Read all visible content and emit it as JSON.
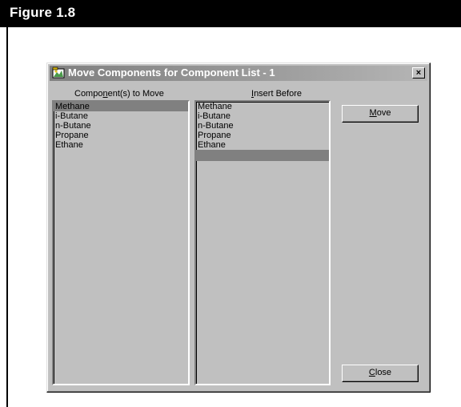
{
  "figure": {
    "title": "Figure 1.8"
  },
  "dialog": {
    "title": "Move Components for Component List - 1",
    "close_glyph": "×"
  },
  "components_to_move": {
    "label_pre": "Compo",
    "label_accel": "n",
    "label_post": "ent(s) to Move",
    "items": [
      "Methane",
      "i-Butane",
      "n-Butane",
      "Propane",
      "Ethane"
    ],
    "selected_index": 0
  },
  "insert_before": {
    "label_pre": "",
    "label_accel": "I",
    "label_post": "nsert Before",
    "items": [
      "Methane",
      "i-Butane",
      "n-Butane",
      "Propane",
      "Ethane",
      ""
    ],
    "selected_index": 5
  },
  "buttons": {
    "move_accel": "M",
    "move_rest": "ove",
    "close_accel": "C",
    "close_rest": "lose"
  },
  "colors": {
    "face": "#c0c0c0",
    "selection": "#808080",
    "title_start": "#808080",
    "title_end": "#b5b5b5"
  }
}
